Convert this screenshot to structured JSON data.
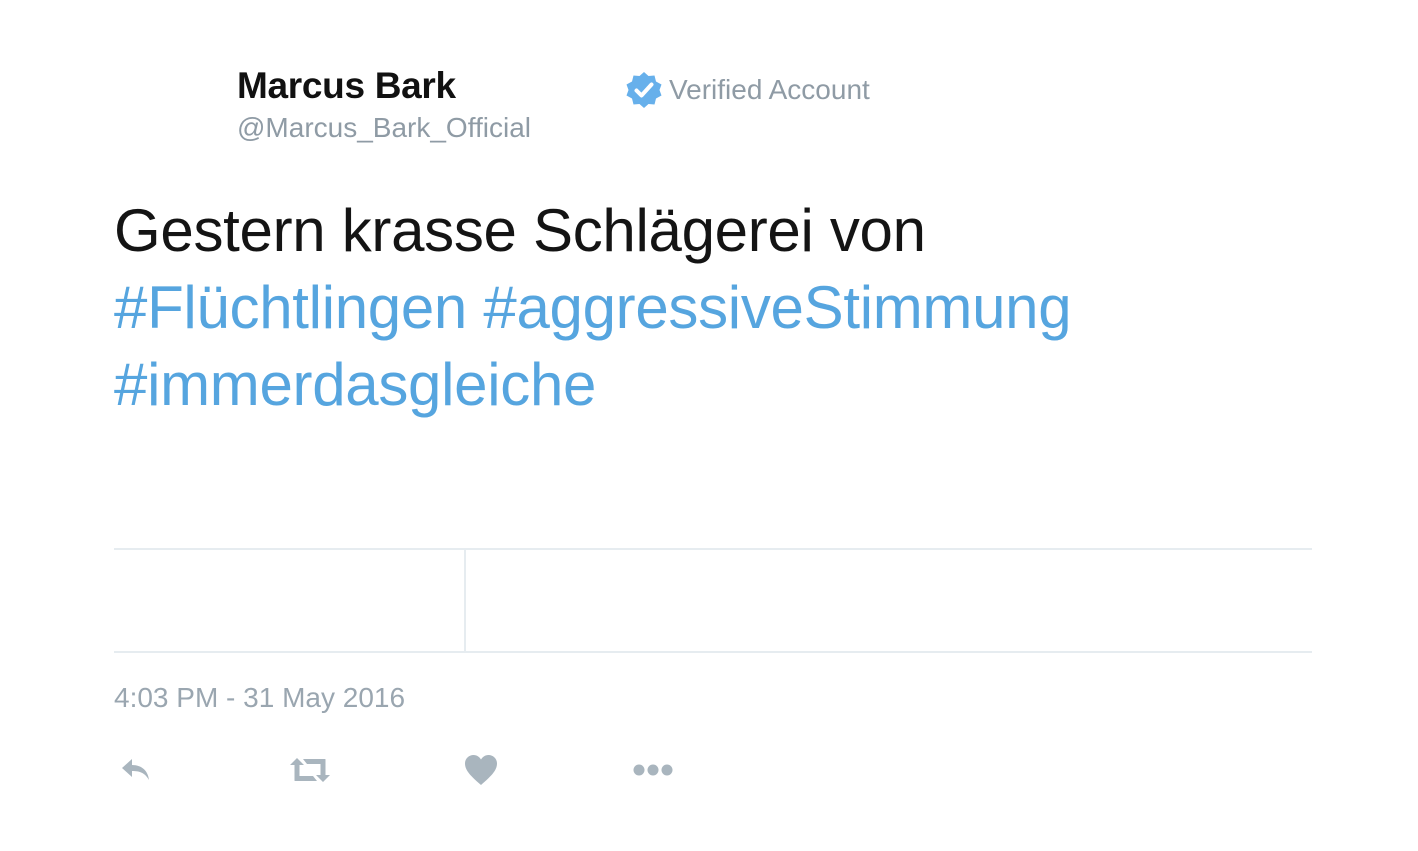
{
  "tweet": {
    "author": {
      "name": "Marcus Bark",
      "handle": "@Marcus_Bark_Official",
      "verified_label": "Verified Account"
    },
    "text": {
      "plain": "Gestern krasse Schlägerei von",
      "hashtags": [
        "#Flüchtlingen",
        "#aggressiveStimmung",
        "#immerdasgleiche"
      ]
    },
    "timestamp": "4:03 PM - 31 May 2016",
    "actions": {
      "icons": [
        "reply-icon",
        "retweet-icon",
        "like-icon",
        "more-icon"
      ]
    }
  },
  "colors": {
    "accent": "#56a5df",
    "verified_badge": "#67b0eb",
    "muted_text": "#8f9ba5",
    "icon": "#a9b5be",
    "divider": "#e6ecf0"
  }
}
